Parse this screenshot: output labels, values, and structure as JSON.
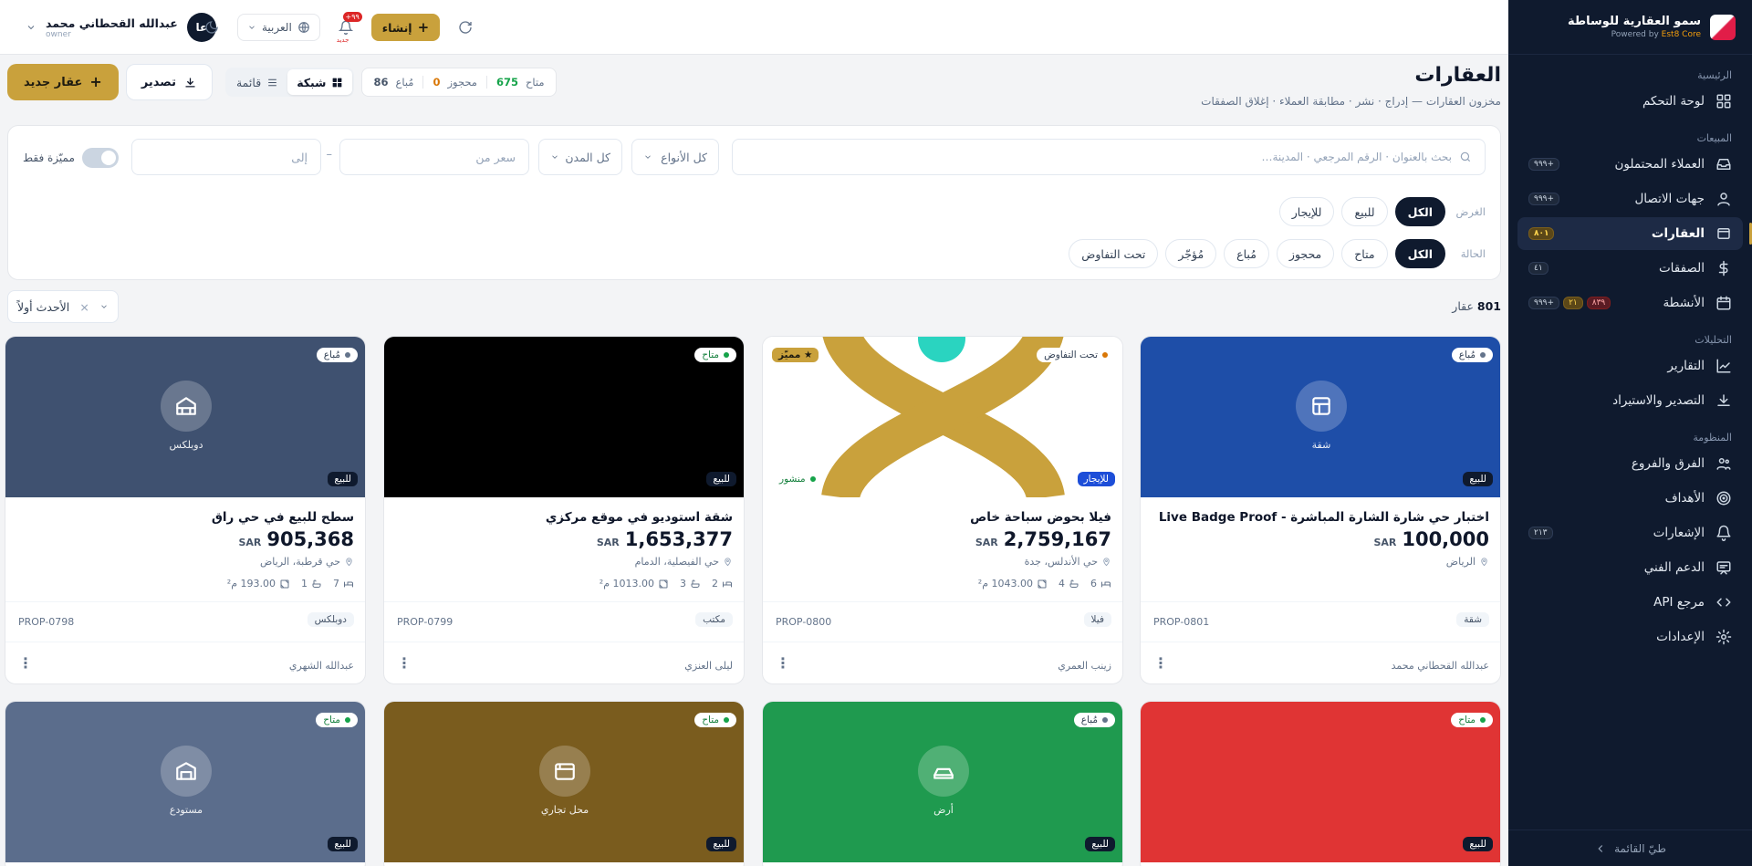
{
  "brand": {
    "name": "سمو العقارية للوساطة",
    "powered_prefix": "Powered by",
    "powered_name": "Est8 Core"
  },
  "sidebar": {
    "sections": {
      "main": "الرئيسية",
      "sales": "المبيعات",
      "analytics": "التحليلات",
      "system": "المنظومة"
    },
    "items": [
      {
        "label": "لوحة التحكم",
        "icon": "dashboard-icon"
      },
      {
        "label": "العملاء المحتملون",
        "icon": "inbox-icon",
        "badges": [
          "+٩٩٩"
        ]
      },
      {
        "label": "جهات الاتصال",
        "icon": "user-icon",
        "badges": [
          "+٩٩٩"
        ]
      },
      {
        "label": "العقارات",
        "icon": "property-icon",
        "badges": [
          "٨٠١"
        ],
        "active": true
      },
      {
        "label": "الصفقات",
        "icon": "dollar-icon",
        "badges": [
          "٤١"
        ]
      },
      {
        "label": "الأنشطة",
        "icon": "calendar-icon",
        "badges": [
          "٨٣٩",
          "٢١",
          "+٩٩٩"
        ]
      },
      {
        "label": "التقارير",
        "icon": "chart-icon"
      },
      {
        "label": "التصدير والاستيراد",
        "icon": "download-icon"
      },
      {
        "label": "الفرق والفروع",
        "icon": "team-icon"
      },
      {
        "label": "الأهداف",
        "icon": "target-icon"
      },
      {
        "label": "الإشعارات",
        "icon": "bell-icon",
        "badges": [
          "٢١٣"
        ]
      },
      {
        "label": "الدعم الفني",
        "icon": "support-icon"
      },
      {
        "label": "مرجع API",
        "icon": "code-icon"
      },
      {
        "label": "الإعدادات",
        "icon": "settings-icon"
      }
    ],
    "collapse_label": "طيّ القائمة"
  },
  "topbar": {
    "user_name": "عبدالله القحطاني محمد",
    "user_role": "owner",
    "avatar_initials": "عا",
    "language": "العربية",
    "bell_badge": "+٩٩",
    "bell_label": "جديد",
    "create_label": "إنشاء"
  },
  "header": {
    "title": "العقارات",
    "subtitle": "مخزون العقارات — إدراج · نشر · مطابقة العملاء · إغلاق الصفقات",
    "new_label": "عقار جديد",
    "export_label": "تصدير",
    "view_grid": "شبكة",
    "view_list": "قائمة",
    "stats": [
      {
        "label": "متاح",
        "value": "675",
        "color": "#16a34a"
      },
      {
        "label": "محجوز",
        "value": "0",
        "color": "#d97706"
      },
      {
        "label": "مُباع",
        "value": "86",
        "color": "#475569"
      }
    ]
  },
  "filters": {
    "search_placeholder": "بحث بالعنوان · الرقم المرجعي · المدينة…",
    "types": "كل الأنواع",
    "cities": "كل المدن",
    "price_from": "سعر من",
    "price_to": "إلى",
    "featured_only": "مميّزة فقط",
    "offer_label": "الغرض",
    "offer_chips": [
      "الكل",
      "للبيع",
      "للإيجار"
    ],
    "status_label": "الحالة",
    "status_chips": [
      "الكل",
      "متاح",
      "محجوز",
      "مُباع",
      "مُؤجّر",
      "تحت التفاوض"
    ]
  },
  "results": {
    "count": "801",
    "unit": "عقار",
    "sort": "الأحدث أولاً"
  },
  "currency": "SAR",
  "cards": [
    {
      "status": "مُباع",
      "status_color": "#64748b",
      "offer": "للبيع",
      "img": "#1e4ea8",
      "ph_label": "شقة",
      "ph_icon": "apartment-icon",
      "title": "اختبار حي شارة الشارة المباشرة - Live Badge Proof",
      "price": "100,000",
      "location": "الرياض",
      "code": "PROP-0801",
      "type": "شقة",
      "agent": "عبدالله القحطاني محمد",
      "specs": null
    },
    {
      "status": "تحت التفاوض",
      "status_color": "#d97706",
      "offer": "للإيجار",
      "featured": "★ مميّز",
      "published": "منشور",
      "img": "logo",
      "title": "فيلا بحوض سباحة خاص",
      "price": "2,759,167",
      "location": "حي الأندلس، جدة",
      "code": "PROP-0800",
      "type": "فيلا",
      "agent": "زينب العمري",
      "specs": {
        "beds": "6",
        "baths": "4",
        "area": "1043.00 م²"
      }
    },
    {
      "status": "متاح",
      "status_color": "#16a34a",
      "offer": "للبيع",
      "img": "#000000",
      "title": "شقة استوديو في موقع مركزي",
      "price": "1,653,377",
      "location": "حي الفيصلية، الدمام",
      "code": "PROP-0799",
      "type": "مكتب",
      "agent": "ليلى العنزي",
      "specs": {
        "beds": "2",
        "baths": "3",
        "area": "1013.00 م²"
      }
    },
    {
      "status": "مُباع",
      "status_color": "#64748b",
      "offer": "للبيع",
      "img": "#3f5170",
      "ph_label": "دوبلكس",
      "ph_icon": "duplex-icon",
      "title": "سطح للبيع في حي راق",
      "price": "905,368",
      "location": "حي قرطبة، الرياض",
      "code": "PROP-0798",
      "type": "دوبلكس",
      "agent": "عبدالله الشهري",
      "specs": {
        "beds": "7",
        "baths": "1",
        "area": "193.00 م²"
      }
    },
    {
      "status": "متاح",
      "status_color": "#16a34a",
      "offer": "للبيع",
      "img": "#e03434"
    },
    {
      "status": "مُباع",
      "status_color": "#64748b",
      "offer": "للبيع",
      "img": "#1f9a4f",
      "ph_label": "أرض",
      "ph_icon": "land-icon"
    },
    {
      "status": "متاح",
      "status_color": "#16a34a",
      "offer": "للبيع",
      "img": "#7a5c1e",
      "ph_label": "محل تجاري",
      "ph_icon": "shop-icon"
    },
    {
      "status": "متاح",
      "status_color": "#16a34a",
      "offer": "للبيع",
      "img": "#5b6d8c",
      "ph_label": "مستودع",
      "ph_icon": "warehouse-icon"
    }
  ]
}
